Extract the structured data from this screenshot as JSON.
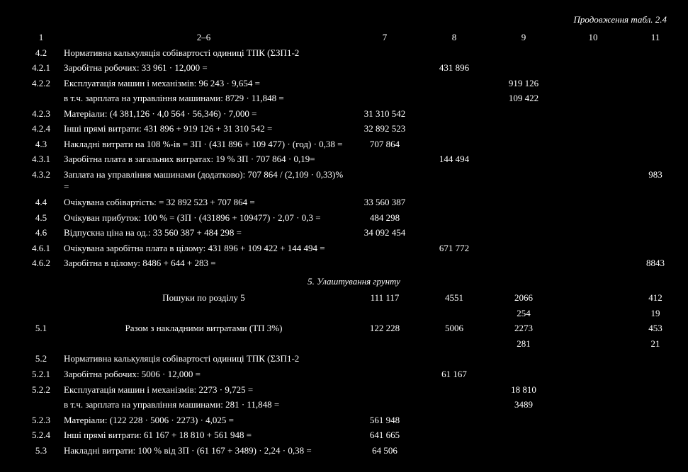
{
  "continuation": "Продовження табл. 2.4",
  "headers": {
    "c1": "1",
    "c2": "2–6",
    "c7": "7",
    "c8": "8",
    "c9": "9",
    "c10": "10",
    "c11": "11"
  },
  "rows": [
    {
      "n": "4.2",
      "t": "Нормативна калькуляція собівартості одиниці ТПК (ΣЗП1-2"
    },
    {
      "n": "4.2.1",
      "t": "Заробітна робочих: 33 961 · 12,000 =",
      "c8": "431 896"
    },
    {
      "n": "4.2.2",
      "t": "Експлуатація машин і механізмів: 96 243 · 9,654 =",
      "c9": "919 126"
    },
    {
      "n": "",
      "t": "в т.ч. зарплата на управління машинами: 8729 · 11,848 =",
      "c9": "109 422"
    },
    {
      "n": "4.2.3",
      "t": "Матеріали: (4 381,126 · 4,0 564 · 56,346) · 7,000 =",
      "c7": "31 310 542"
    },
    {
      "n": "4.2.4",
      "t": "Інші прямі витрати: 431 896 + 919 126 + 31 310 542 =",
      "c7": "32 892 523"
    },
    {
      "n": "4.3",
      "t": "Накладні витрати на 108 %-ів = ЗП · (431 896 + 109 477) · (год) · 0,38 =",
      "c7": "707 864"
    },
    {
      "n": "4.3.1",
      "t": "Заробітна плата в загальних витратах: 19 % ЗП · 707 864 · 0,19=",
      "c8": "144 494"
    },
    {
      "n": "4.3.2",
      "t": "Заплата на управління машинами (додатково): 707 864 / (2,109 · 0,33)% =",
      "c11": "983"
    },
    {
      "n": "4.4",
      "t": "Очікувана собівартість: = 32 892 523 + 707 864 =",
      "c7": "33 560 387"
    },
    {
      "n": "4.5",
      "t": "Очікуван прибуток: 100 % = (ЗП · (431896 + 109477) · 2,07 · 0,3 =",
      "c7": "484 298"
    },
    {
      "n": "4.6",
      "t": "Відпускна ціна на од.: 33 560 387 + 484 298 =",
      "c7": "34 092 454"
    },
    {
      "n": "4.6.1",
      "t": "Очікувана заробітна плата в цілому: 431 896 + 109 422 + 144 494 =",
      "c8": "671 772"
    },
    {
      "n": "4.6.2",
      "t": "Заробітна в цілому: 8486 + 644 + 283 =",
      "c11": "8843"
    }
  ],
  "section5": "5. Улаштування грунту",
  "row51": {
    "label": "Пошуки по розділу 5",
    "c7": "111 117",
    "c8": "4551",
    "r1c9": "2066",
    "r1c11": "412",
    "r2c9": "254",
    "r2c11": "19"
  },
  "row5i": {
    "n": "5.1",
    "label": "Разом з накладними витратами (ТП 3%)",
    "c7": "122 228",
    "c8": "5006",
    "r1c9": "2273",
    "r1c11": "453",
    "r2c9": "281",
    "r2c11": "21"
  },
  "rows5": [
    {
      "n": "5.2",
      "t": "Нормативна калькуляція собівартості одиниці ТПК (ΣЗП1-2"
    },
    {
      "n": "5.2.1",
      "t": "Заробітна робочих: 5006 · 12,000 =",
      "c8": "61 167"
    },
    {
      "n": "5.2.2",
      "t": "Експлуатація машин і механізмів: 2273 · 9,725 =",
      "c9": "18 810"
    },
    {
      "n": "",
      "t": "в т.ч. зарплата на управління машинами: 281 · 11,848 =",
      "c9": "3489"
    },
    {
      "n": "5.2.3",
      "t": "Матеріали: (122 228 · 5006 · 2273) · 4,025 =",
      "c7": "561 948"
    },
    {
      "n": "5.2.4",
      "t": "Інші прямі витрати: 61 167 + 18 810 + 561 948 =",
      "c7": "641 665"
    },
    {
      "n": "5.3",
      "t": "Накладні витрати: 100 % від ЗП · (61 167 + 3489) · 2,24 · 0,38 =",
      "c7": "64 506"
    }
  ]
}
